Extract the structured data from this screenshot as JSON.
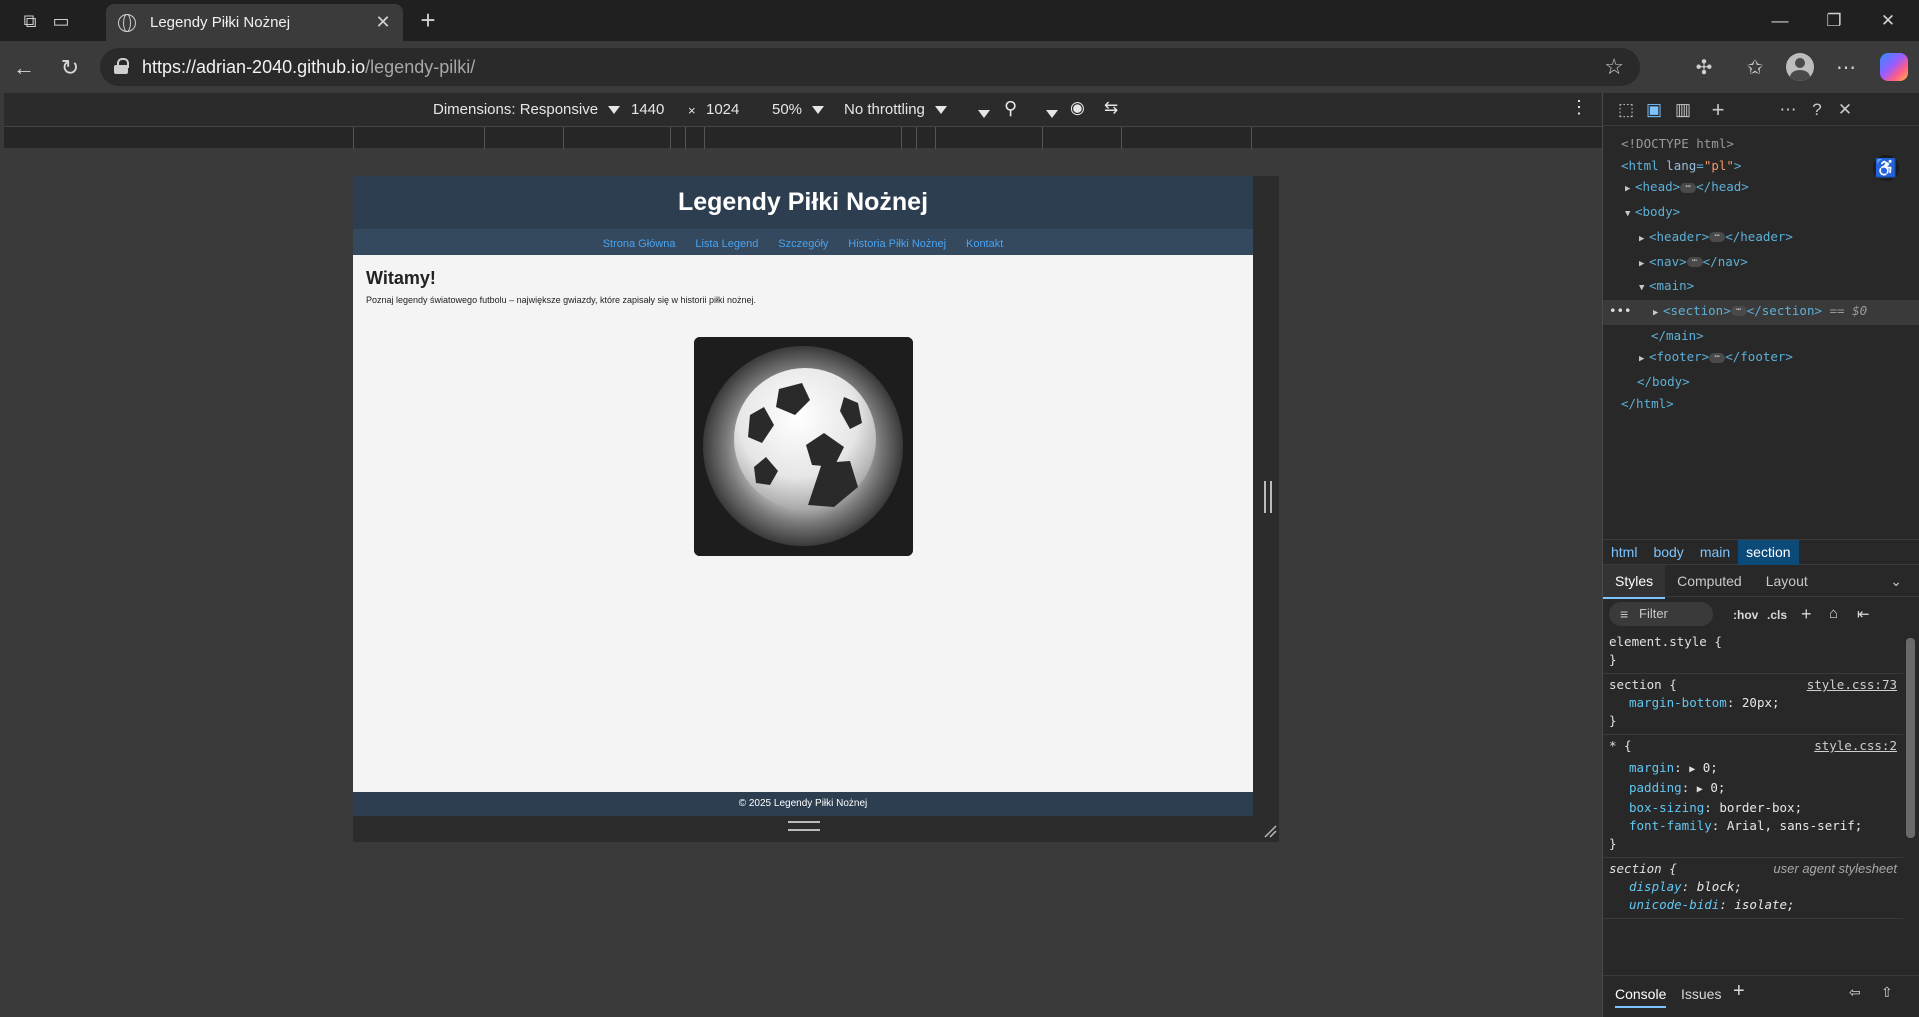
{
  "browser": {
    "tab_title": "Legendy Piłki Nożnej",
    "url_host": "https://adrian-2040.github.io",
    "url_path": "/legendy-pilki/"
  },
  "device_toolbar": {
    "dimensions_label": "Dimensions: Responsive",
    "width": "1440",
    "times": "×",
    "height": "1024",
    "zoom": "50%",
    "throttling": "No throttling"
  },
  "site": {
    "title": "Legendy Piłki Nożnej",
    "nav": [
      "Strona Główna",
      "Lista Legend",
      "Szczegóły",
      "Historia Piłki Nożnej",
      "Kontakt"
    ],
    "heading": "Witamy!",
    "intro": "Poznaj legendy światowego futbolu – największe gwiazdy, które zapisały się w historii piłki nożnej.",
    "footer": "© 2025 Legendy Piłki Nożnej"
  },
  "devtools": {
    "dom": {
      "doctype": "<!DOCTYPE html>",
      "html_open_tag": "<html",
      "html_attr_name": "lang",
      "html_attr_value": "\"pl\"",
      "head": "<head>",
      "head_close": "</head>",
      "body": "<body>",
      "header": "<header>",
      "header_close": "</header>",
      "nav": "<nav>",
      "nav_close": "</nav>",
      "main": "<main>",
      "section": "<section>",
      "section_close": "</section>",
      "selected_marker": "== $0",
      "main_close": "</main>",
      "footer": "<footer>",
      "footer_close": "</footer>",
      "body_close": "</body>",
      "html_close": "</html>"
    },
    "breadcrumbs": [
      "html",
      "body",
      "main",
      "section"
    ],
    "panel_tabs": [
      "Styles",
      "Computed",
      "Layout"
    ],
    "filter_placeholder": "Filter",
    "hov": ":hov",
    "cls": ".cls",
    "rules": {
      "element_style": "element.style {",
      "section_selector": "section {",
      "section_src": "style.css:73",
      "margin_bottom_name": "margin-bottom",
      "margin_bottom_value": "20px;",
      "star_selector": "* {",
      "star_src": "style.css:2",
      "margin_name": "margin",
      "margin_value": "0;",
      "padding_name": "padding",
      "padding_value": "0;",
      "box_sizing_name": "box-sizing",
      "box_sizing_value": "border-box;",
      "font_family_name": "font-family",
      "font_family_value": "Arial, sans-serif;",
      "ua_selector": "section {",
      "ua_src": "user agent stylesheet",
      "display_name": "display",
      "display_value": "block;",
      "unicode_bidi_name": "unicode-bidi",
      "unicode_bidi_value": "isolate;",
      "close_brace": "}"
    },
    "drawer_tabs": [
      "Console",
      "Issues"
    ]
  },
  "colors": {
    "site_header_bg": "#2c3e50",
    "site_nav_bg": "#34495e",
    "nav_link": "#4aa3f0",
    "breadcrumb_active": "#0c4a7a"
  }
}
